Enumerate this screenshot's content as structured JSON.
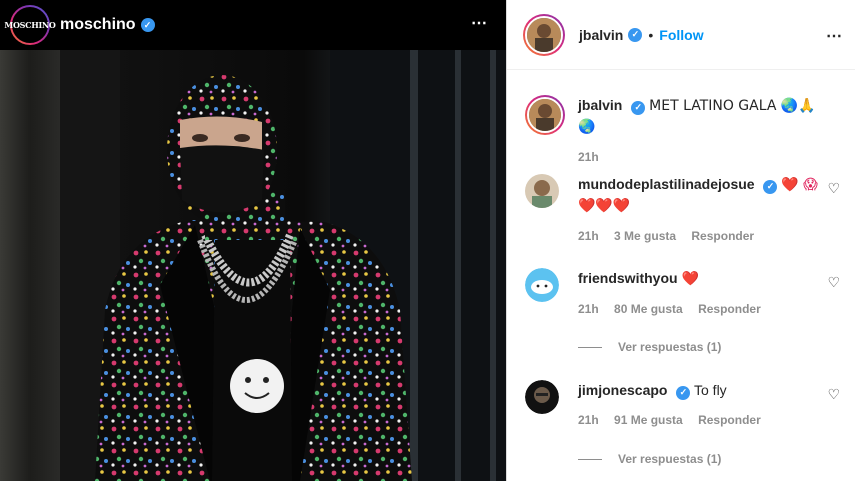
{
  "post": {
    "account": "moschino",
    "logo_text": "MOSCHINO",
    "more_icon": "⋯"
  },
  "panel": {
    "header": {
      "username": "jbalvin",
      "separator": "•",
      "follow_label": "Follow",
      "more_icon": "⋯"
    },
    "caption": {
      "username": "jbalvin",
      "text": "MET LATINO GALA 🌏🙏🌏",
      "time": "21h"
    },
    "comments": [
      {
        "username": "mundodeplastilinadejosue",
        "text": "❤️ 😱❤️❤️❤️",
        "time": "21h",
        "likes": "3 Me gusta",
        "reply": "Responder"
      },
      {
        "username": "friendswithyou",
        "text": "❤️",
        "time": "21h",
        "likes": "80 Me gusta",
        "reply": "Responder",
        "replies": "Ver respuestas (1)"
      },
      {
        "username": "jimjonescapo",
        "text": "To fly",
        "time": "21h",
        "likes": "91 Me gusta",
        "reply": "Responder",
        "replies": "Ver respuestas (1)"
      }
    ]
  },
  "colors": {
    "accent": "#0095f6",
    "verified": "#3897f0",
    "heart": "#e0245e"
  },
  "icons": {
    "verified": "verified-badge-icon",
    "like": "heart-outline-icon",
    "more": "more-options-icon"
  }
}
